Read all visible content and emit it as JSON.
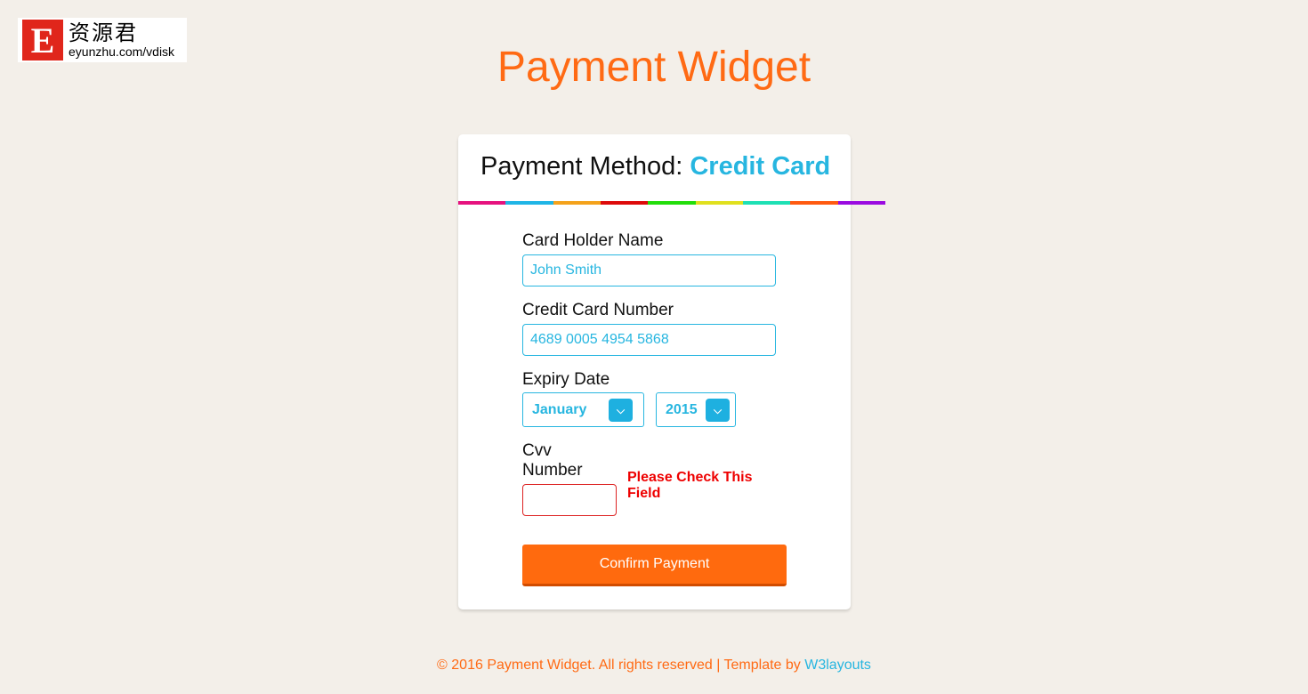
{
  "logo": {
    "letter": "E",
    "cn": "资源君",
    "url": "eyunzhu.com/vdisk"
  },
  "title": "Payment Widget",
  "card": {
    "method_label": "Payment Method:",
    "method_value": "Credit Card",
    "rainbow": [
      "#e6127e",
      "#1fb5e6",
      "#f4a21b",
      "#dd0a0a",
      "#22dd0a",
      "#e0e01e",
      "#1de0b4",
      "#ff5a10",
      "#9a0ae0"
    ],
    "holder": {
      "label": "Card Holder Name",
      "value": "John Smith"
    },
    "number": {
      "label": "Credit Card Number",
      "value": "4689 0005 4954 5868"
    },
    "expiry": {
      "label": "Expiry Date",
      "month": "January",
      "year": "2015"
    },
    "cvv": {
      "label": "Cvv Number",
      "value": "",
      "error": "Please Check This Field"
    },
    "confirm": "Confirm Payment"
  },
  "footer": {
    "text": "© 2016 Payment Widget. All rights reserved | Template by ",
    "link": "W3layouts"
  },
  "colors": {
    "accent": "#ff6a14",
    "primary": "#27b6e0",
    "error": "#ee0000"
  }
}
